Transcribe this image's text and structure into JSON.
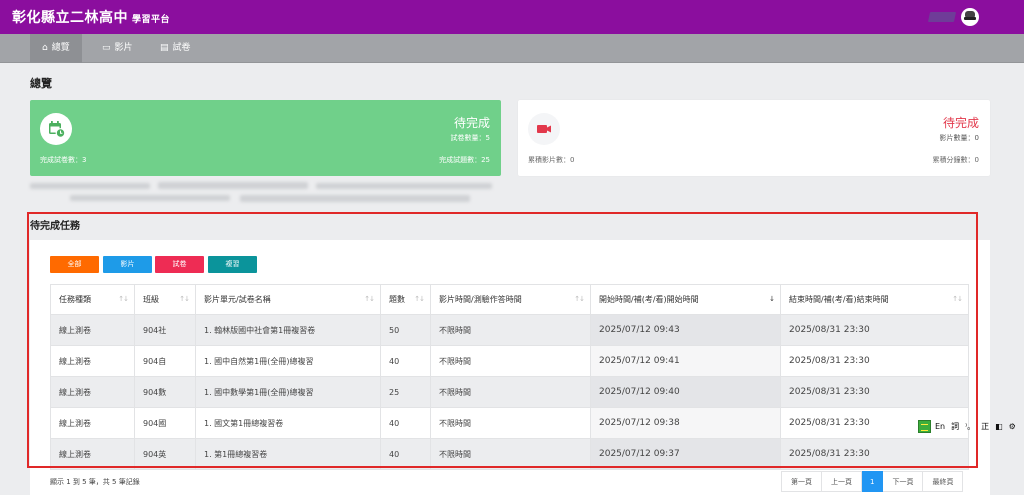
{
  "header": {
    "title": "彰化縣立二林高中",
    "subtitle": "學習平台"
  },
  "nav": {
    "tabs": [
      {
        "label": "總覽",
        "icon": "home-icon",
        "active": true
      },
      {
        "label": "影片",
        "icon": "video-icon",
        "active": false
      },
      {
        "label": "試卷",
        "icon": "document-icon",
        "active": false
      }
    ]
  },
  "page_title": "總覽",
  "cards": {
    "exam": {
      "icon": "calendar-clock-icon",
      "status": "待完成",
      "count_label": "試卷數量：5",
      "footer_left": "完成試卷數：3",
      "footer_right": "完成試題數：25"
    },
    "video": {
      "icon": "video-camera-icon",
      "status": "待完成",
      "count_label": "影片數量：0",
      "footer_left": "累積影片數：0",
      "footer_right": "累積分鐘數：0"
    }
  },
  "tasks": {
    "title": "待完成任務",
    "filters": [
      {
        "label": "全部",
        "color": "#ff6a00"
      },
      {
        "label": "影片",
        "color": "#1e9be8"
      },
      {
        "label": "試卷",
        "color": "#ee2c54"
      },
      {
        "label": "複習",
        "color": "#0b949b"
      }
    ],
    "columns": [
      "任務種類",
      "班級",
      "影片單元/試卷名稱",
      "題數",
      "影片時間/測驗作答時間",
      "開始時間/補(考/看)開始時間",
      "結束時間/補(考/看)結束時間"
    ],
    "rows": [
      [
        "線上測卷",
        "904社",
        "1. 翰林版國中社會第1冊複習卷",
        "50",
        "不限時間",
        "2025/07/12 09:43",
        "2025/08/31 23:30"
      ],
      [
        "線上測卷",
        "904自",
        "1. 國中自然第1冊(全冊)總複習",
        "40",
        "不限時間",
        "2025/07/12 09:41",
        "2025/08/31 23:30"
      ],
      [
        "線上測卷",
        "904數",
        "1. 國中數學第1冊(全冊)總複習",
        "25",
        "不限時間",
        "2025/07/12 09:40",
        "2025/08/31 23:30"
      ],
      [
        "線上測卷",
        "904國",
        "1. 國文第1冊總複習卷",
        "40",
        "不限時間",
        "2025/07/12 09:38",
        "2025/08/31 23:30"
      ],
      [
        "線上測卷",
        "904英",
        "1. 第1冊總複習卷",
        "40",
        "不限時間",
        "2025/07/12 09:37",
        "2025/08/31 23:30"
      ]
    ],
    "info": "顯示 1 到 5 筆，共 5 筆記錄",
    "pagination": [
      "第一頁",
      "上一頁",
      "1",
      "下一頁",
      "最終頁"
    ]
  },
  "ime_toolbar": {
    "labels": [
      "En",
      "詞",
      "⁾。",
      "正"
    ],
    "icons": [
      "ime-logo-icon",
      "half-square-icon",
      "gear-icon"
    ]
  }
}
